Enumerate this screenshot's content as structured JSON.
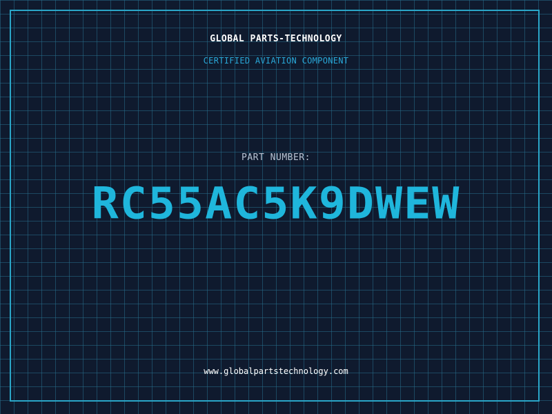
{
  "header": {
    "company": "GLOBAL PARTS-TECHNOLOGY",
    "subtitle": "CERTIFIED AVIATION COMPONENT"
  },
  "part": {
    "label": "PART NUMBER:",
    "number": "RC55AC5K9DWEW"
  },
  "footer": {
    "url": "www.globalpartstechnology.com"
  },
  "colors": {
    "background": "#0f1a2e",
    "grid": "#266e8a",
    "frame": "#2aa6c8",
    "accent": "#1fb6dc",
    "subtitle": "#29a8d8",
    "label": "#b9c4d4",
    "text": "#ffffff"
  }
}
